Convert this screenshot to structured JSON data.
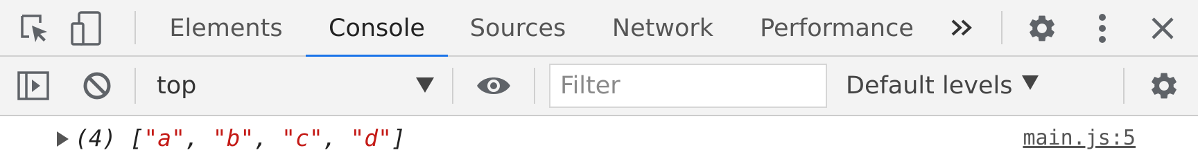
{
  "tabbar": {
    "tabs": [
      {
        "label": "Elements",
        "active": false
      },
      {
        "label": "Console",
        "active": true
      },
      {
        "label": "Sources",
        "active": false
      },
      {
        "label": "Network",
        "active": false
      },
      {
        "label": "Performance",
        "active": false
      }
    ],
    "overflow_icon": "chevron-double-right-icon",
    "icons": [
      "inspect-element-icon",
      "device-toolbar-icon",
      "gear-icon",
      "kebab-menu-icon",
      "close-icon"
    ],
    "active_color": "#1a73e8"
  },
  "toolbar": {
    "icons": [
      "sidebar-toggle-icon",
      "clear-console-icon",
      "eye-icon",
      "gear-icon"
    ],
    "context": "top",
    "filter_placeholder": "Filter",
    "filter_value": "",
    "levels_label": "Default levels"
  },
  "console": {
    "entries": [
      {
        "count": "(4)",
        "open_bracket": "[",
        "items": [
          "\"a\"",
          "\"b\"",
          "\"c\"",
          "\"d\""
        ],
        "separator": ", ",
        "close_bracket": "]",
        "source": "main.js:5",
        "string_color": "#c41a16"
      }
    ]
  }
}
